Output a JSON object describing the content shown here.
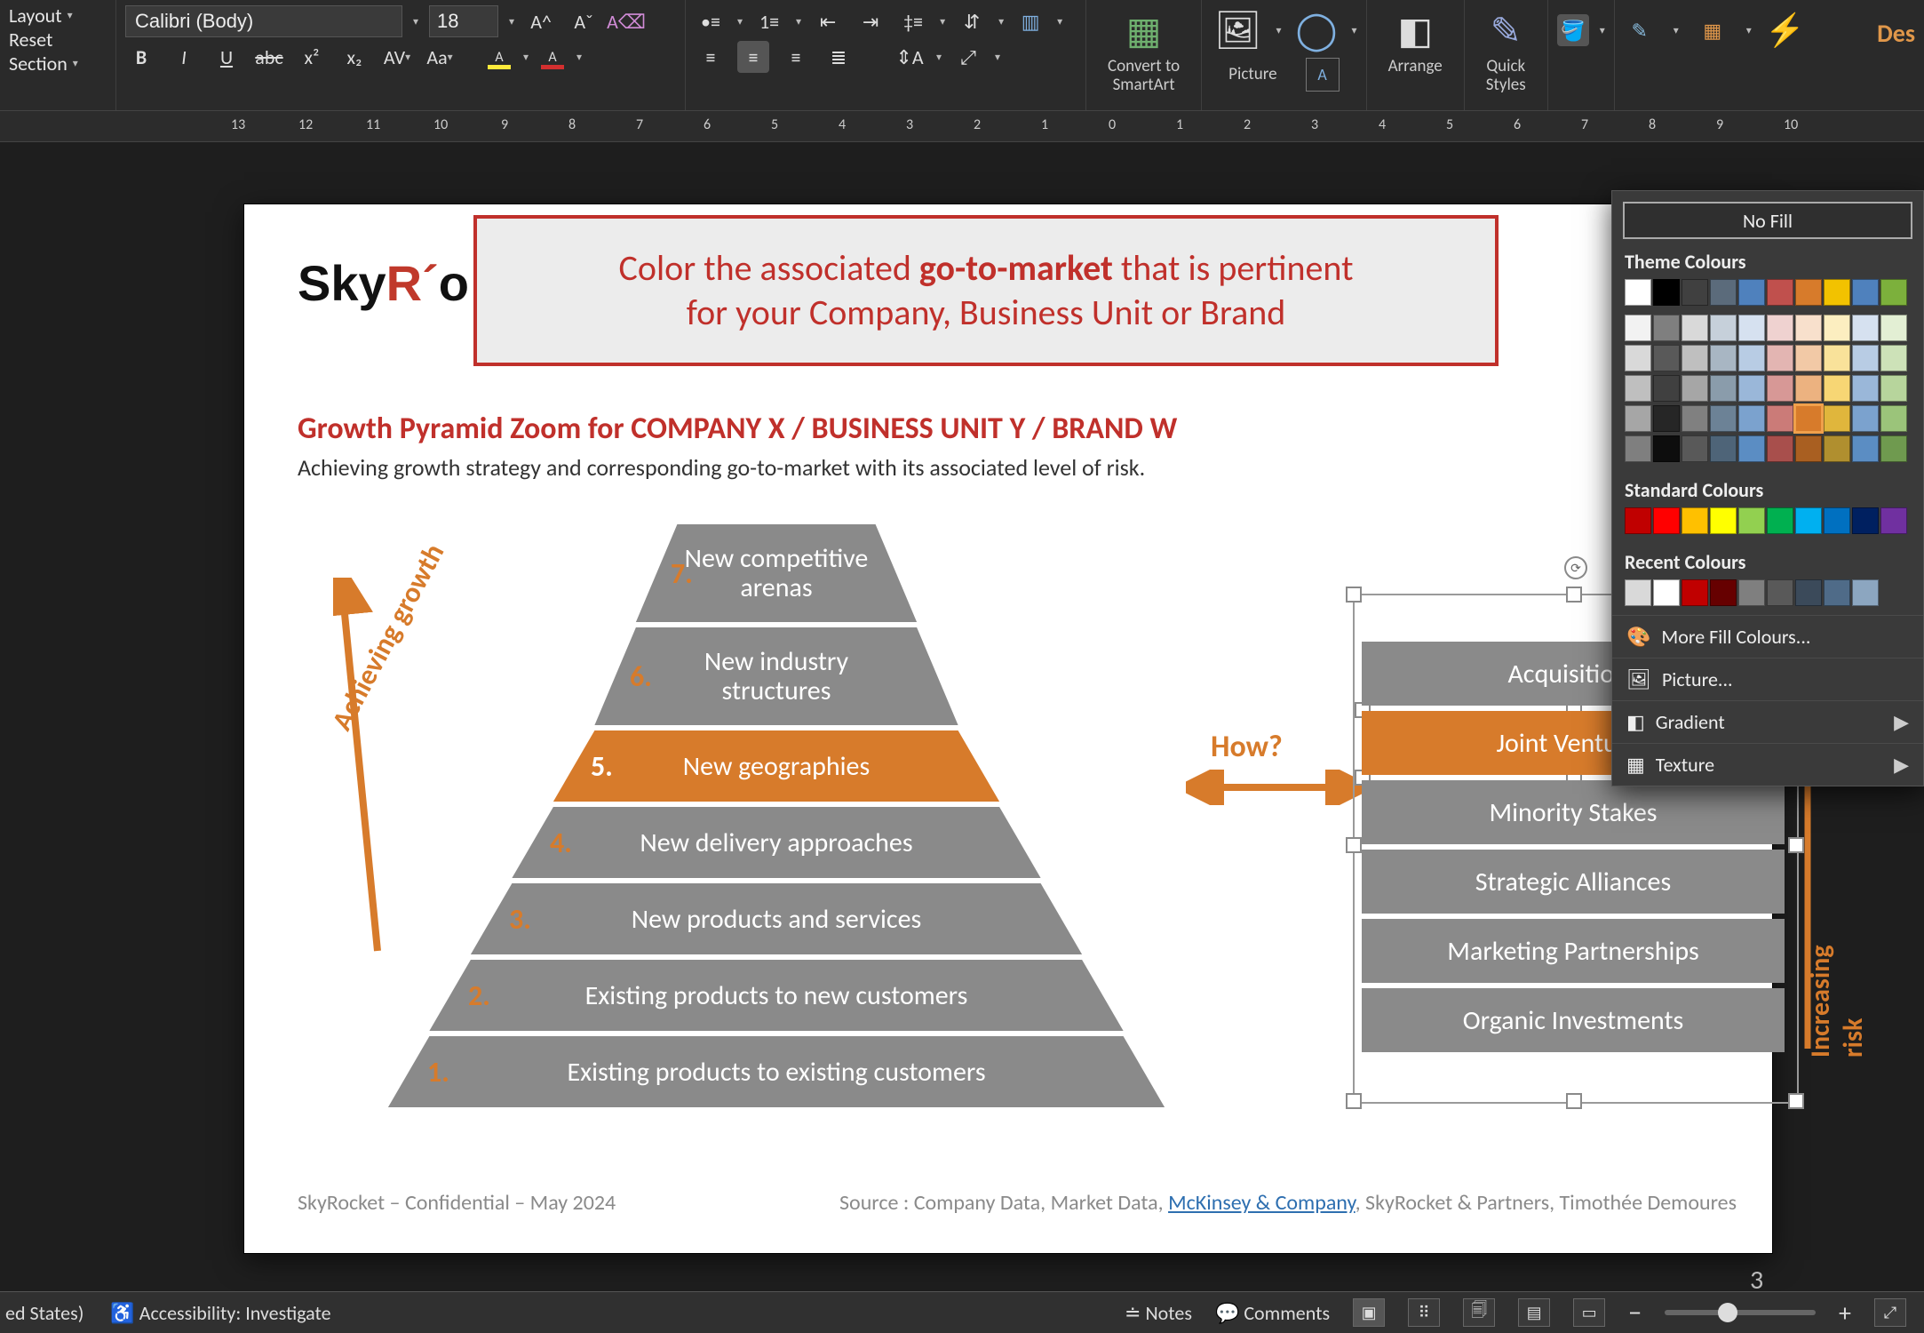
{
  "ribbon": {
    "layout": "Layout",
    "reset": "Reset",
    "section": "Section",
    "font_name": "Calibri (Body)",
    "font_size": "18",
    "bold": "B",
    "italic": "I",
    "underline": "U",
    "strike": "abc",
    "sup": "x²",
    "sub": "x₂",
    "spacing": "AV",
    "case": "Aa",
    "convert1": "Convert to",
    "convert2": "SmartArt",
    "picture": "Picture",
    "arrange": "Arrange",
    "quick1": "Quick",
    "quick2": "Styles",
    "des": "Des"
  },
  "ruler": [
    "13",
    "12",
    "11",
    "10",
    "9",
    "8",
    "7",
    "6",
    "5",
    "4",
    "3",
    "2",
    "1",
    "0",
    "1",
    "2",
    "3",
    "4",
    "5",
    "6",
    "7",
    "8",
    "9",
    "10"
  ],
  "callout": {
    "line1_a": "Color the associated ",
    "line1_b": "go-to-market",
    "line1_c": " that is pertinent",
    "line2": "for your Company, Business Unit or Brand"
  },
  "slide": {
    "logo_a": "Sky",
    "logo_b": "R",
    "logo_c": "o",
    "title": "Growth Pyramid Zoom for COMPANY X / BUSINESS UNIT Y / BRAND W",
    "subtitle": "Achieving growth strategy and corresponding go-to-market with its associated level of risk.",
    "grow": "Achieving growth",
    "how": "How?",
    "risk": "Increasing risk",
    "rows": [
      {
        "n": "7.",
        "t": "New competitive\narenas"
      },
      {
        "n": "6.",
        "t": "New industry\nstructures"
      },
      {
        "n": "5.",
        "t": "New geographies"
      },
      {
        "n": "4.",
        "t": "New delivery approaches"
      },
      {
        "n": "3.",
        "t": "New products and services"
      },
      {
        "n": "2.",
        "t": "Existing products to new customers"
      },
      {
        "n": "1.",
        "t": "Existing products to existing customers"
      }
    ],
    "gtm": [
      "Acquisitions",
      "Joint Ventures",
      "Minority Stakes",
      "Strategic Alliances",
      "Marketing Partnerships",
      "Organic Investments"
    ],
    "foot_l": "SkyRocket – Confidential – May 2024",
    "foot_r_a": "Source : Company Data, Market Data, ",
    "foot_r_link": "McKinsey & Company",
    "foot_r_b": ", SkyRocket & Partners, Timothée Demoures",
    "page": "3"
  },
  "fill": {
    "nofill": "No Fill",
    "theme": "Theme Colours",
    "standard": "Standard Colours",
    "recent": "Recent Colours",
    "more": "More Fill Colours...",
    "picture": "Picture...",
    "gradient": "Gradient",
    "texture": "Texture",
    "theme_row1": [
      "#ffffff",
      "#000000",
      "#404040",
      "#5b6b7b",
      "#4f81bd",
      "#c0504d",
      "#d77b2b",
      "#f2c200",
      "#4f81bd",
      "#7cb03c"
    ],
    "theme_shades": [
      [
        "#f2f2f2",
        "#7f7f7f",
        "#d9d9d9",
        "#c6d0da",
        "#d6e1f0",
        "#efd2d0",
        "#f8e0cc",
        "#fceec0",
        "#d6e1f0",
        "#e3efd4"
      ],
      [
        "#d9d9d9",
        "#595959",
        "#bfbfbf",
        "#a8b6c3",
        "#b8cce4",
        "#e3b5b2",
        "#f2c9a6",
        "#f9e29a",
        "#b8cce4",
        "#cde2b8"
      ],
      [
        "#bfbfbf",
        "#404040",
        "#a6a6a6",
        "#8a9cab",
        "#9ab7d9",
        "#d79896",
        "#ecb280",
        "#f7d674",
        "#9ab7d9",
        "#b7d59c"
      ],
      [
        "#a6a6a6",
        "#262626",
        "#808080",
        "#6c8296",
        "#7ba2ce",
        "#cb7b78",
        "#d77b2b",
        "#e0b63c",
        "#7ba2ce",
        "#9bc47a"
      ],
      [
        "#7f7f7f",
        "#0d0d0d",
        "#595959",
        "#4e6478",
        "#5b8dc3",
        "#a84f4c",
        "#a95f21",
        "#b08f2f",
        "#5b8dc3",
        "#6f9a4f"
      ]
    ],
    "standard_row": [
      "#c00000",
      "#ff0000",
      "#ffc000",
      "#ffff00",
      "#92d050",
      "#00b050",
      "#00b0f0",
      "#0070c0",
      "#002060",
      "#7030a0"
    ],
    "recent_row": [
      "#d9d9d9",
      "#ffffff",
      "#c00000",
      "#660000",
      "#7f7f7f",
      "#595959",
      "#3b4a5a",
      "#4f6b88",
      "#8ca6c0"
    ]
  },
  "status": {
    "lang": "ed States)",
    "access": "Accessibility: Investigate",
    "notes": "Notes",
    "comments": "Comments",
    "minus": "−",
    "plus": "+"
  }
}
